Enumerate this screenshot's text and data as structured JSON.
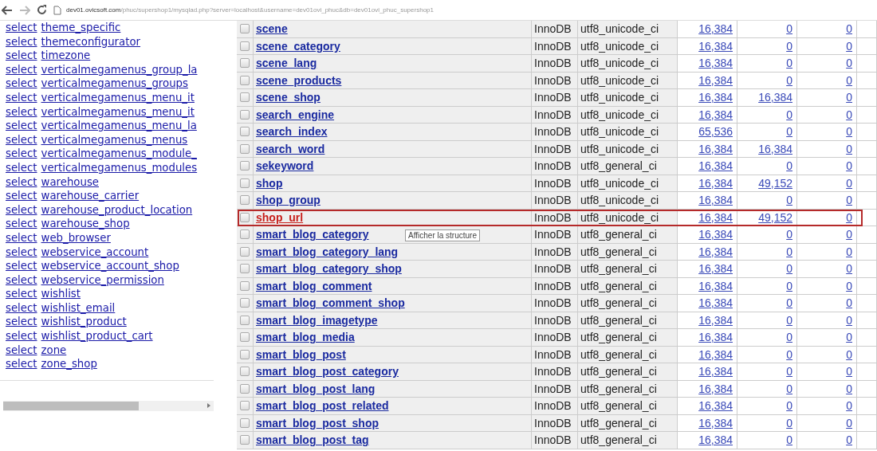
{
  "browser": {
    "url_host": "dev01.ovicsoft.com",
    "url_path": "/phuc/supershop1/mysqlad.php?server=localhost&username=dev01ovi_phuc&db=dev01ovi_phuc_supershop1"
  },
  "sidebar": {
    "items": [
      {
        "action": "select",
        "name": "theme_specific"
      },
      {
        "action": "select",
        "name": "themeconfigurator"
      },
      {
        "action": "select",
        "name": "timezone"
      },
      {
        "action": "select",
        "name": "verticalmegamenus_group_la"
      },
      {
        "action": "select",
        "name": "verticalmegamenus_groups"
      },
      {
        "action": "select",
        "name": "verticalmegamenus_menu_it"
      },
      {
        "action": "select",
        "name": "verticalmegamenus_menu_it"
      },
      {
        "action": "select",
        "name": "verticalmegamenus_menu_la"
      },
      {
        "action": "select",
        "name": "verticalmegamenus_menus"
      },
      {
        "action": "select",
        "name": "verticalmegamenus_module_"
      },
      {
        "action": "select",
        "name": "verticalmegamenus_modules"
      },
      {
        "action": "select",
        "name": "warehouse"
      },
      {
        "action": "select",
        "name": "warehouse_carrier"
      },
      {
        "action": "select",
        "name": "warehouse_product_location"
      },
      {
        "action": "select",
        "name": "warehouse_shop"
      },
      {
        "action": "select",
        "name": "web_browser"
      },
      {
        "action": "select",
        "name": "webservice_account"
      },
      {
        "action": "select",
        "name": "webservice_account_shop"
      },
      {
        "action": "select",
        "name": "webservice_permission"
      },
      {
        "action": "select",
        "name": "wishlist"
      },
      {
        "action": "select",
        "name": "wishlist_email"
      },
      {
        "action": "select",
        "name": "wishlist_product"
      },
      {
        "action": "select",
        "name": "wishlist_product_cart"
      },
      {
        "action": "select",
        "name": "zone"
      },
      {
        "action": "select",
        "name": "zone_shop"
      }
    ]
  },
  "table": {
    "rows": [
      {
        "name": "scene",
        "engine": "InnoDB",
        "collation": "utf8_unicode_ci",
        "column_4": "16,384",
        "column_5": "0",
        "column_6": "0",
        "checked": false,
        "highlighted": false
      },
      {
        "name": "scene_category",
        "engine": "InnoDB",
        "collation": "utf8_unicode_ci",
        "column_4": "16,384",
        "column_5": "0",
        "column_6": "0",
        "checked": false,
        "highlighted": false
      },
      {
        "name": "scene_lang",
        "engine": "InnoDB",
        "collation": "utf8_unicode_ci",
        "column_4": "16,384",
        "column_5": "0",
        "column_6": "0",
        "checked": false,
        "highlighted": false
      },
      {
        "name": "scene_products",
        "engine": "InnoDB",
        "collation": "utf8_unicode_ci",
        "column_4": "16,384",
        "column_5": "0",
        "column_6": "0",
        "checked": false,
        "highlighted": false
      },
      {
        "name": "scene_shop",
        "engine": "InnoDB",
        "collation": "utf8_unicode_ci",
        "column_4": "16,384",
        "column_5": "16,384",
        "column_6": "0",
        "checked": false,
        "highlighted": false
      },
      {
        "name": "search_engine",
        "engine": "InnoDB",
        "collation": "utf8_unicode_ci",
        "column_4": "16,384",
        "column_5": "0",
        "column_6": "0",
        "checked": false,
        "highlighted": false
      },
      {
        "name": "search_index",
        "engine": "InnoDB",
        "collation": "utf8_unicode_ci",
        "column_4": "65,536",
        "column_5": "0",
        "column_6": "0",
        "checked": false,
        "highlighted": false
      },
      {
        "name": "search_word",
        "engine": "InnoDB",
        "collation": "utf8_unicode_ci",
        "column_4": "16,384",
        "column_5": "16,384",
        "column_6": "0",
        "checked": false,
        "highlighted": false
      },
      {
        "name": "sekeyword",
        "engine": "InnoDB",
        "collation": "utf8_general_ci",
        "column_4": "16,384",
        "column_5": "0",
        "column_6": "0",
        "checked": false,
        "highlighted": false
      },
      {
        "name": "shop",
        "engine": "InnoDB",
        "collation": "utf8_unicode_ci",
        "column_4": "16,384",
        "column_5": "49,152",
        "column_6": "0",
        "checked": false,
        "highlighted": false
      },
      {
        "name": "shop_group",
        "engine": "InnoDB",
        "collation": "utf8_unicode_ci",
        "column_4": "16,384",
        "column_5": "0",
        "column_6": "0",
        "checked": false,
        "highlighted": false
      },
      {
        "name": "shop_url",
        "engine": "InnoDB",
        "collation": "utf8_unicode_ci",
        "column_4": "16,384",
        "column_5": "49,152",
        "column_6": "0",
        "checked": false,
        "highlighted": true
      },
      {
        "name": "smart_blog_category",
        "engine": "InnoDB",
        "collation": "utf8_general_ci",
        "column_4": "16,384",
        "column_5": "0",
        "column_6": "0",
        "checked": false,
        "highlighted": false,
        "tooltip": "Afficher la structure"
      },
      {
        "name": "smart_blog_category_lang",
        "engine": "InnoDB",
        "collation": "utf8_general_ci",
        "column_4": "16,384",
        "column_5": "0",
        "column_6": "0",
        "checked": false,
        "highlighted": false
      },
      {
        "name": "smart_blog_category_shop",
        "engine": "InnoDB",
        "collation": "utf8_general_ci",
        "column_4": "16,384",
        "column_5": "0",
        "column_6": "0",
        "checked": false,
        "highlighted": false
      },
      {
        "name": "smart_blog_comment",
        "engine": "InnoDB",
        "collation": "utf8_general_ci",
        "column_4": "16,384",
        "column_5": "0",
        "column_6": "0",
        "checked": false,
        "highlighted": false
      },
      {
        "name": "smart_blog_comment_shop",
        "engine": "InnoDB",
        "collation": "utf8_general_ci",
        "column_4": "16,384",
        "column_5": "0",
        "column_6": "0",
        "checked": false,
        "highlighted": false
      },
      {
        "name": "smart_blog_imagetype",
        "engine": "InnoDB",
        "collation": "utf8_general_ci",
        "column_4": "16,384",
        "column_5": "0",
        "column_6": "0",
        "checked": false,
        "highlighted": false
      },
      {
        "name": "smart_blog_media",
        "engine": "InnoDB",
        "collation": "utf8_general_ci",
        "column_4": "16,384",
        "column_5": "0",
        "column_6": "0",
        "checked": false,
        "highlighted": false
      },
      {
        "name": "smart_blog_post",
        "engine": "InnoDB",
        "collation": "utf8_general_ci",
        "column_4": "16,384",
        "column_5": "0",
        "column_6": "0",
        "checked": false,
        "highlighted": false
      },
      {
        "name": "smart_blog_post_category",
        "engine": "InnoDB",
        "collation": "utf8_general_ci",
        "column_4": "16,384",
        "column_5": "0",
        "column_6": "0",
        "checked": false,
        "highlighted": false
      },
      {
        "name": "smart_blog_post_lang",
        "engine": "InnoDB",
        "collation": "utf8_general_ci",
        "column_4": "16,384",
        "column_5": "0",
        "column_6": "0",
        "checked": false,
        "highlighted": false
      },
      {
        "name": "smart_blog_post_related",
        "engine": "InnoDB",
        "collation": "utf8_general_ci",
        "column_4": "16,384",
        "column_5": "0",
        "column_6": "0",
        "checked": false,
        "highlighted": false
      },
      {
        "name": "smart_blog_post_shop",
        "engine": "InnoDB",
        "collation": "utf8_general_ci",
        "column_4": "16,384",
        "column_5": "0",
        "column_6": "0",
        "checked": false,
        "highlighted": false
      },
      {
        "name": "smart_blog_post_tag",
        "engine": "InnoDB",
        "collation": "utf8_general_ci",
        "column_4": "16,384",
        "column_5": "0",
        "column_6": "0",
        "checked": false,
        "highlighted": false
      }
    ]
  }
}
